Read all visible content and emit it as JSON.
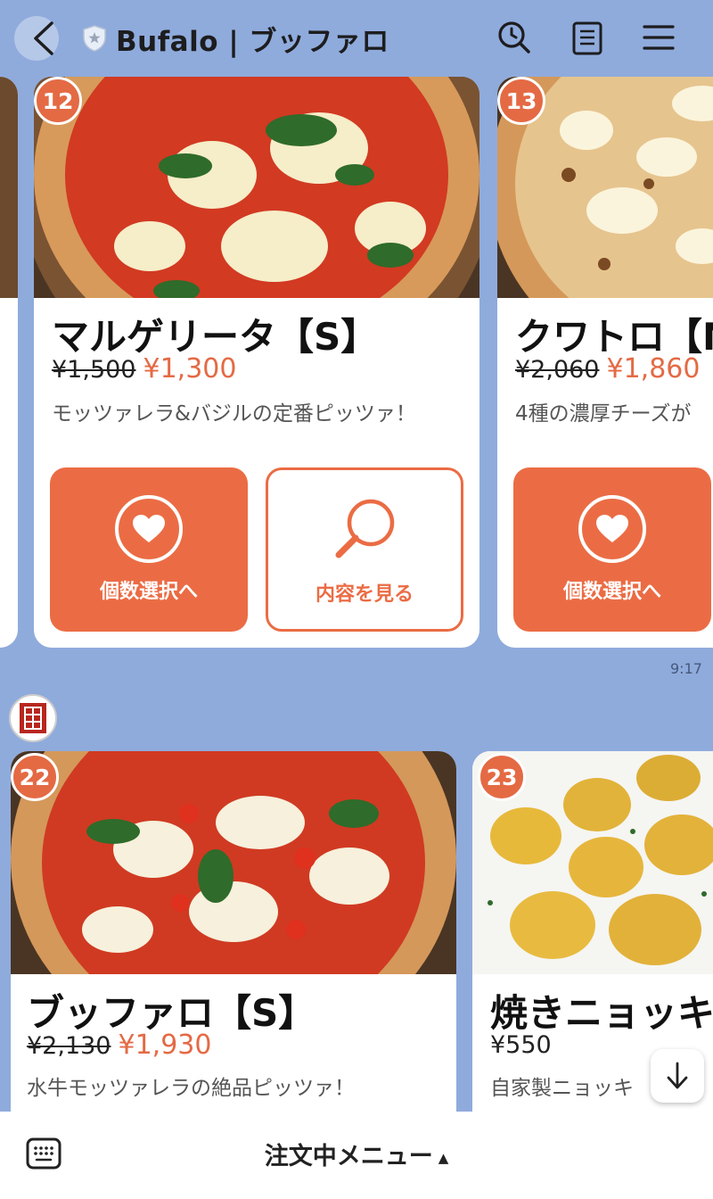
{
  "header": {
    "title": "Bufalo | ブッファロ",
    "back_icon": "chevron-left-icon",
    "verified_icon": "shield-icon",
    "actions": [
      "search-icon",
      "notes-icon",
      "menu-icon"
    ]
  },
  "messages": [
    {
      "time": "9:17",
      "cards": [
        {
          "number": "12",
          "name": "マルゲリータ【S】",
          "old_price": "¥1,500",
          "price": "¥1,300",
          "description": "モッツァレラ&バジルの定番ピッツァ！",
          "buttons": [
            "個数選択へ",
            "内容を見る"
          ]
        },
        {
          "number": "13",
          "name": "クワトロ【M",
          "old_price": "¥2,060",
          "price": "¥1,860",
          "description": "4種の濃厚チーズが",
          "buttons": [
            "個数選択へ"
          ]
        }
      ]
    },
    {
      "cards": [
        {
          "number": "22",
          "name": "ブッファロ【S】",
          "old_price": "¥2,130",
          "price": "¥1,930",
          "description": "水牛モッツァレラの絶品ピッツァ！"
        },
        {
          "number": "23",
          "name": "焼きニョッキ",
          "price": "¥550",
          "description": "自家製ニョッキ"
        }
      ]
    }
  ],
  "bottom_bar": {
    "label": "注文中メニュー",
    "caret": "▲",
    "keyboard_icon": "keyboard-icon"
  },
  "colors": {
    "background": "#8FABDC",
    "accent": "#EB6C44",
    "badge": "#E46A44"
  }
}
